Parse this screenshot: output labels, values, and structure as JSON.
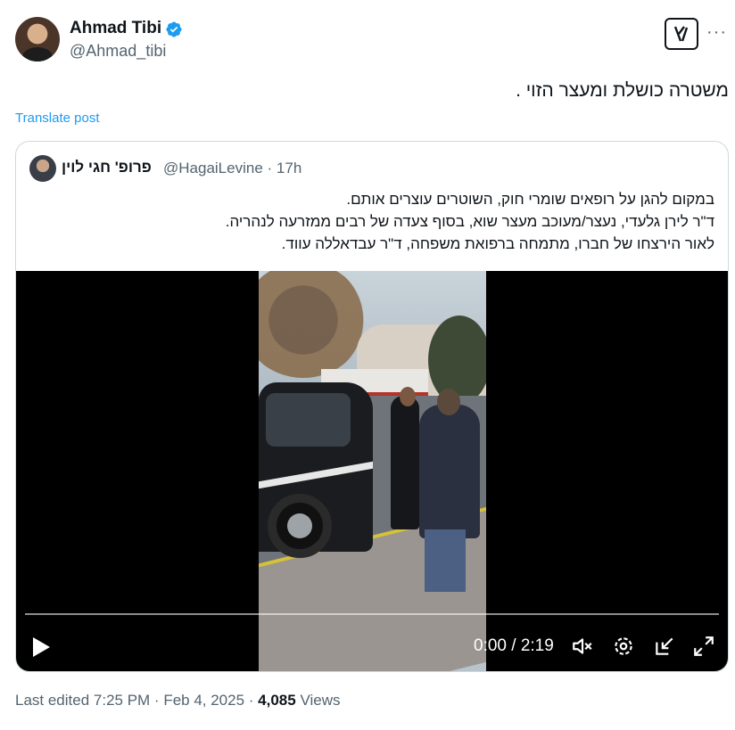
{
  "author": {
    "name": "Ahmad Tibi",
    "handle": "@Ahmad_tibi",
    "verified": true
  },
  "tweet": {
    "text": "משטרה כושלת ומעצר הזוי .",
    "translate_label": "Translate post"
  },
  "quoted": {
    "name": "פרופ' חגי לוין",
    "handle": "@HagaiLevine",
    "separator": "·",
    "time": "17h",
    "lines": [
      "במקום להגן על רופאים שומרי חוק, השוטרים עוצרים אותם.",
      "ד\"ר לירן גלעדי, נעצר/מעוכב מעצר שוא, בסוף צעדה של רבים ממזרעה לנהריה.",
      "לאור הירצחו של חברו, מתמחה ברפואת משפחה, ד\"ר עבדאללה עווד."
    ]
  },
  "video": {
    "current_time": "0:00",
    "separator": "/",
    "duration": "2:19",
    "progress": 0
  },
  "meta": {
    "edited": "Last edited 7:25 PM · Feb 4, 2025 ·",
    "views_count": "4,085",
    "views_label": "Views"
  },
  "colors": {
    "accent": "#1d9bf0",
    "secondary_text": "#536471",
    "primary_text": "#0f1419",
    "border": "#cfd9de"
  },
  "icons": [
    "verified-badge-icon",
    "grok-icon",
    "more-icon",
    "play-icon",
    "volume-icon",
    "settings-icon",
    "pip-icon",
    "fullscreen-icon"
  ]
}
